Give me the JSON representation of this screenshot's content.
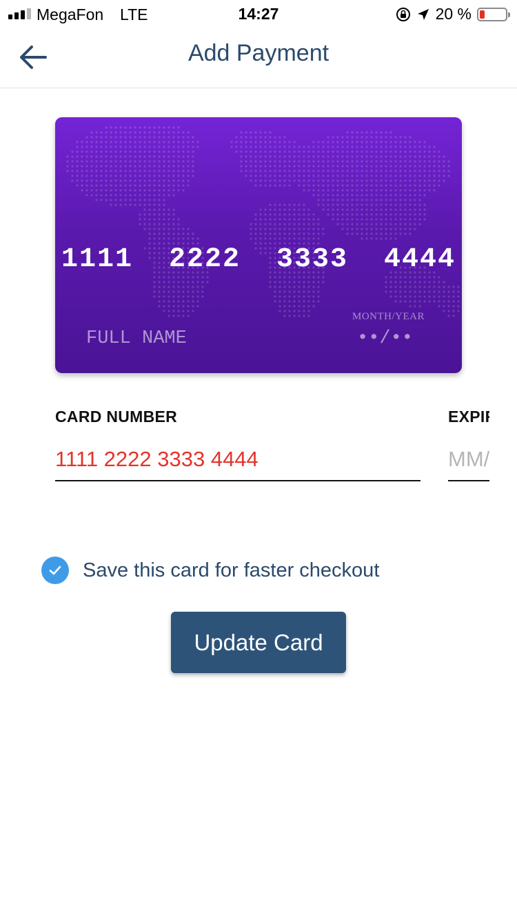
{
  "status_bar": {
    "carrier": "MegaFon",
    "network": "LTE",
    "time": "14:27",
    "battery_percent": "20 %",
    "battery_level": 0.2,
    "battery_color": "#e2321f",
    "icons": [
      "signal-icon",
      "orientation-lock-icon",
      "location-arrow-icon",
      "battery-icon"
    ]
  },
  "nav": {
    "title": "Add Payment",
    "back_icon": "arrow-left-icon"
  },
  "card_preview": {
    "number": "1111  2222  3333  4444",
    "name_placeholder": "FULL NAME",
    "expiry_label": "MONTH/YEAR",
    "expiry_value": "••/••",
    "gradient_top": "#7424d6",
    "gradient_bottom": "#4a1496",
    "background_image": "world-map-dots"
  },
  "form": {
    "card_number_label": "CARD NUMBER",
    "card_number_value": "1111 2222 3333 4444",
    "card_number_color": "#e2342b",
    "expiry_label": "EXPIRY",
    "expiry_placeholder": "MM/YY"
  },
  "save_card": {
    "checked": true,
    "label": "Save this card for faster checkout",
    "check_icon": "checkmark-icon",
    "checkbox_color": "#3f9be8"
  },
  "actions": {
    "update_label": "Update Card",
    "button_color": "#2d5478"
  }
}
